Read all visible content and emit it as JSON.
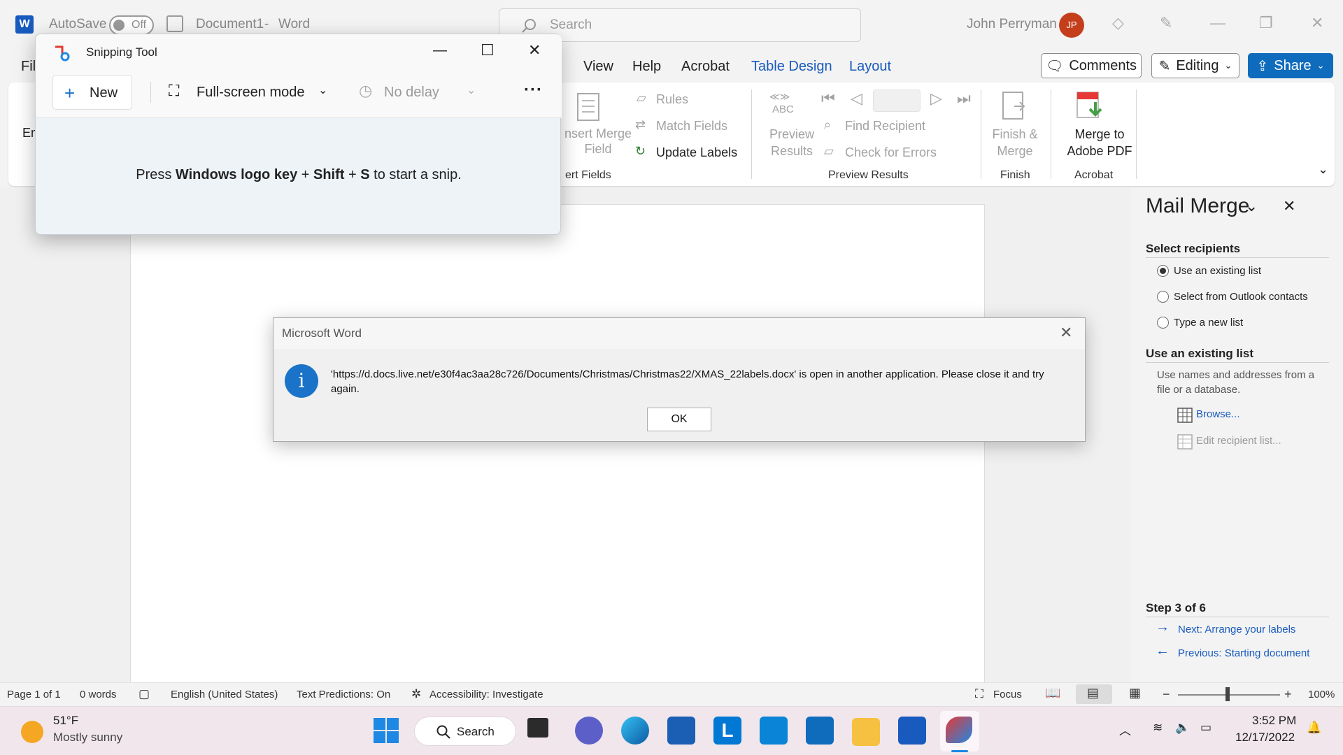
{
  "titlebar": {
    "autosave_label": "AutoSave",
    "autosave_state": "Off",
    "doc_title": "Document1",
    "separator": "-",
    "app_name": "Word",
    "search_placeholder": "Search",
    "user_name": "John Perryman",
    "user_initials": "JP"
  },
  "menu": {
    "file_partial": "Fil",
    "tabs": [
      "View",
      "Help",
      "Acrobat",
      "Table Design",
      "Layout"
    ],
    "comments_label": "Comments",
    "editing_label": "Editing",
    "share_label": "Share"
  },
  "ribbon": {
    "left_partial": "En",
    "insert_merge_field": [
      "nsert Merge",
      "Field"
    ],
    "rules": "Rules",
    "match_fields": "Match Fields",
    "update_labels": "Update Labels",
    "group_fields_partial": "ert Fields",
    "preview_abc": "ABC",
    "preview_results_btn": [
      "Preview",
      "Results"
    ],
    "find_recipient": "Find Recipient",
    "check_errors": "Check for Errors",
    "group_preview": "Preview Results",
    "finish_merge": [
      "Finish &",
      "Merge"
    ],
    "group_finish": "Finish",
    "merge_pdf": [
      "Merge to",
      "Adobe PDF"
    ],
    "group_acrobat": "Acrobat"
  },
  "snipping": {
    "title": "Snipping Tool",
    "new_label": "New",
    "mode_label": "Full-screen mode",
    "delay_label": "No delay",
    "hint_pre": "Press ",
    "hint_key1": "Windows logo key",
    "hint_plus1": " + ",
    "hint_key2": "Shift",
    "hint_plus2": " + ",
    "hint_key3": "S",
    "hint_post": " to start a snip."
  },
  "dialog": {
    "title": "Microsoft Word",
    "message": "'https://d.docs.live.net/e30f4ac3aa28c726/Documents/Christmas/Christmas22/XMAS_22labels.docx' is open in another application. Please close it and try again.",
    "ok_label": "OK",
    "info_glyph": "i"
  },
  "pane": {
    "title": "Mail Merge",
    "select_recipients": "Select recipients",
    "options": [
      "Use an existing list",
      "Select from Outlook contacts",
      "Type a new list"
    ],
    "selected_option": 0,
    "use_existing": "Use an existing list",
    "use_existing_desc": "Use names and addresses from a file or a database.",
    "browse": "Browse...",
    "edit_list": "Edit recipient list...",
    "step": "Step 3 of 6",
    "next": "Next: Arrange your labels",
    "previous": "Previous: Starting document"
  },
  "statusbar": {
    "page": "Page 1 of 1",
    "words": "0 words",
    "language": "English (United States)",
    "predictions": "Text Predictions: On",
    "accessibility": "Accessibility: Investigate",
    "focus": "Focus",
    "zoom": "100%",
    "zoom_minus": "−",
    "zoom_plus": "+"
  },
  "taskbar": {
    "temp": "51°F",
    "weather": "Mostly sunny",
    "search": "Search",
    "l_glyph": "L",
    "time": "3:52 PM",
    "date": "12/17/2022"
  },
  "colors": {
    "accent": "#185abd",
    "share": "#0f6cbd",
    "avatar": "#c43e1c",
    "info": "#1a73c8"
  }
}
